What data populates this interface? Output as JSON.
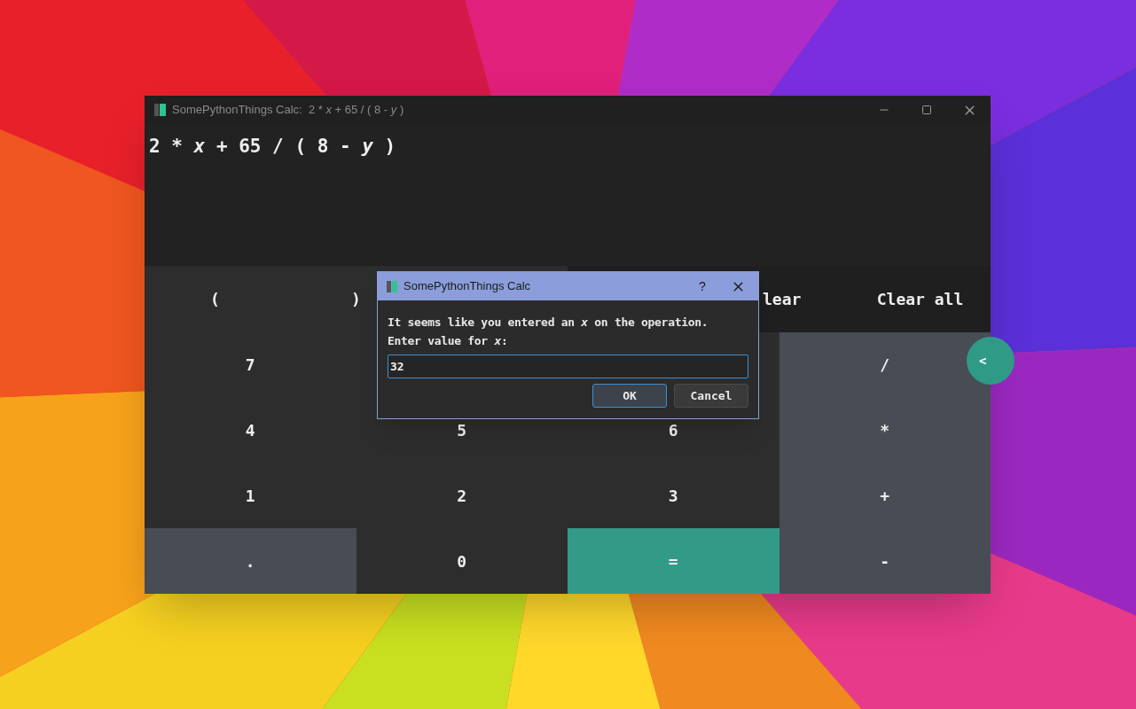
{
  "window": {
    "title": "SomePythonThings Calc:  2 * *x* + 65 / ( 8 - *y* )"
  },
  "display": {
    "expression": "2 * *x* + 65 / ( 8 - *y* )"
  },
  "top_row": {
    "left_keys": [
      "(",
      ")"
    ],
    "right_keys": [
      "lear",
      "Clear all"
    ]
  },
  "keypad": [
    [
      {
        "label": "7",
        "kind": "digit"
      },
      {
        "kind": "digit"
      },
      {
        "kind": "digit"
      },
      {
        "label": "/",
        "kind": "operator"
      }
    ],
    [
      {
        "label": "4",
        "kind": "digit"
      },
      {
        "label": "5",
        "kind": "digit"
      },
      {
        "label": "6",
        "kind": "digit"
      },
      {
        "label": "*",
        "kind": "operator"
      }
    ],
    [
      {
        "label": "1",
        "kind": "digit"
      },
      {
        "label": "2",
        "kind": "digit"
      },
      {
        "label": "3",
        "kind": "digit"
      },
      {
        "label": "+",
        "kind": "operator"
      }
    ],
    [
      {
        "label": ".",
        "kind": "operator"
      },
      {
        "label": "0",
        "kind": "digit"
      },
      {
        "label": "=",
        "kind": "equals"
      },
      {
        "label": "-",
        "kind": "operator"
      }
    ]
  ],
  "side_button": {
    "label": "<"
  },
  "dialog": {
    "title": "SomePythonThings Calc",
    "help": "?",
    "message": [
      "It seems like you entered an *x* on the operation.",
      "Enter value for *x*:"
    ],
    "value": "32",
    "buttons": [
      {
        "label": "OK",
        "default": true
      },
      {
        "label": "Cancel",
        "default": false
      }
    ]
  }
}
